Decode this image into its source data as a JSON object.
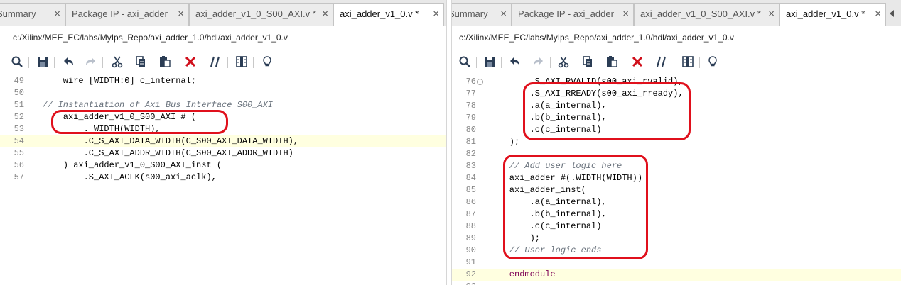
{
  "left": {
    "tabs": [
      {
        "label": "Summary",
        "close": "×",
        "active": false
      },
      {
        "label": "Package IP - axi_adder",
        "close": "×",
        "active": false
      },
      {
        "label": "axi_adder_v1_0_S00_AXI.v *",
        "close": "×",
        "active": false
      },
      {
        "label": "axi_adder_v1_0.v *",
        "close": "×",
        "active": true
      }
    ],
    "file_path": "c:/Xilinx/MEE_EC/labs/MyIps_Repo/axi_adder_1.0/hdl/axi_adder_v1_0.v",
    "lines": [
      {
        "n": "49",
        "text": "    wire [WIDTH:0] c_internal;"
      },
      {
        "n": "50",
        "text": ""
      },
      {
        "n": "51",
        "text": "// Instantiation of Axi Bus Interface S00_AXI"
      },
      {
        "n": "52",
        "text": "    axi_adder_v1_0_S00_AXI # ("
      },
      {
        "n": "53",
        "text": "        . WIDTH(WIDTH),"
      },
      {
        "n": "54",
        "text": "        .C_S_AXI_DATA_WIDTH(C_S00_AXI_DATA_WIDTH),"
      },
      {
        "n": "55",
        "text": "        .C_S_AXI_ADDR_WIDTH(C_S00_AXI_ADDR_WIDTH)"
      },
      {
        "n": "56",
        "text": "    ) axi_adder_v1_0_S00_AXI_inst ("
      },
      {
        "n": "57",
        "text": "        .S_AXI_ACLK(s00_axi_aclk),"
      }
    ]
  },
  "right": {
    "tabs": [
      {
        "label": "Summary",
        "close": "×",
        "active": false
      },
      {
        "label": "Package IP - axi_adder",
        "close": "×",
        "active": false
      },
      {
        "label": "axi_adder_v1_0_S00_AXI.v *",
        "close": "×",
        "active": false
      },
      {
        "label": "axi_adder_v1_0.v *",
        "close": "×",
        "active": true
      }
    ],
    "file_path": "c:/Xilinx/MEE_EC/labs/MyIps_Repo/axi_adder_1.0/hdl/axi_adder_v1_0.v",
    "lines": [
      {
        "n": "76",
        "text": "        .S_AXI_RVALID(s00_axi_rvalid),"
      },
      {
        "n": "77",
        "text": "        .S_AXI_RREADY(s00_axi_rready),"
      },
      {
        "n": "78",
        "text": "        .a(a_internal),"
      },
      {
        "n": "79",
        "text": "        .b(b_internal),"
      },
      {
        "n": "80",
        "text": "        .c(c_internal)"
      },
      {
        "n": "81",
        "text": "    );"
      },
      {
        "n": "82",
        "text": ""
      },
      {
        "n": "83",
        "text": "    // Add user logic here"
      },
      {
        "n": "84",
        "text": "    axi_adder #(.WIDTH(WIDTH))"
      },
      {
        "n": "85",
        "text": "    axi_adder_inst("
      },
      {
        "n": "86",
        "text": "        .a(a_internal),"
      },
      {
        "n": "87",
        "text": "        .b(b_internal),"
      },
      {
        "n": "88",
        "text": "        .c(c_internal)"
      },
      {
        "n": "89",
        "text": "        );"
      },
      {
        "n": "90",
        "text": "    // User logic ends"
      },
      {
        "n": "91",
        "text": ""
      },
      {
        "n": "92",
        "text": "    endmodule"
      },
      {
        "n": "93",
        "text": ""
      }
    ]
  },
  "toolbar_icons": [
    "search-icon",
    "save-icon",
    "undo-icon",
    "redo-icon",
    "cut-icon",
    "copy-icon",
    "paste-icon",
    "delete-icon",
    "comment-toggle-icon",
    "column-select-icon",
    "insert-template-icon"
  ],
  "colors": {
    "annotation": "#e0101c",
    "keyword": "#7f0055",
    "comment": "#6a737d",
    "delete": "#d0101c",
    "highlight": "#ffffe0"
  }
}
